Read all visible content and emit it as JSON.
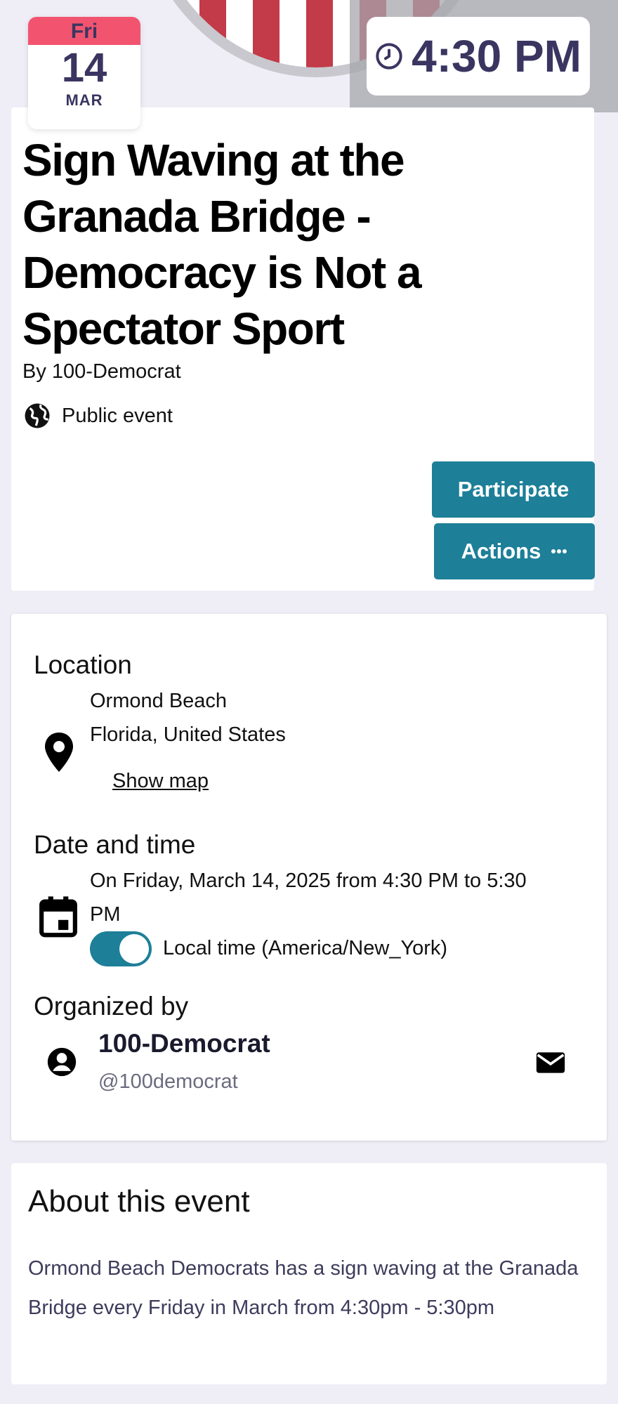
{
  "header": {
    "time": "4:30 PM",
    "date_badge": {
      "weekday": "Fri",
      "day": "14",
      "month": "MAR"
    }
  },
  "event": {
    "title": "Sign Waving at the Granada Bridge - Democracy is Not a Spectator Sport",
    "by_line": "By 100-Democrat",
    "visibility": "Public event",
    "buttons": {
      "participate": "Participate",
      "actions": "Actions"
    }
  },
  "details": {
    "location": {
      "heading": "Location",
      "line1": "Ormond Beach",
      "line2": "Florida, United States",
      "show_map": "Show map"
    },
    "datetime": {
      "heading": "Date and time",
      "line1": "On Friday, March 14, 2025 from 4:30 PM to 5:30",
      "line2": "PM",
      "toggle_label": "Local time (America/New_York)",
      "toggle_on": true
    },
    "organizer": {
      "heading": "Organized by",
      "name": "100-Democrat",
      "handle": "@100democrat"
    }
  },
  "about": {
    "heading": "About this event",
    "text": "Ormond Beach Democrats has a sign waving at the Granada Bridge every Friday in March from 4:30pm - 5:30pm"
  },
  "colors": {
    "accent": "#1d7f98",
    "date_header": "#f25470",
    "badge_text": "#3a3560",
    "page_bg": "#efeef6"
  }
}
